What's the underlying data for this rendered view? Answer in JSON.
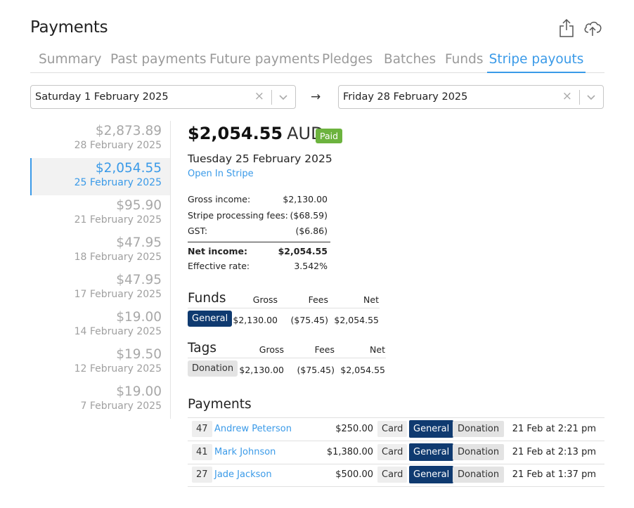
{
  "page": {
    "title": "Payments",
    "icons": [
      "share-icon",
      "cloud-upload-icon"
    ]
  },
  "tabs": [
    {
      "label": "Summary"
    },
    {
      "label": "Past payments"
    },
    {
      "label": "Future payments"
    },
    {
      "label": "Pledges"
    },
    {
      "label": "Batches"
    },
    {
      "label": "Funds"
    },
    {
      "label": "Stripe payouts",
      "active": true
    }
  ],
  "date_range": {
    "from": "Saturday 1 February 2025",
    "to": "Friday 28 February 2025",
    "arrow": "→",
    "clear_glyph": "×"
  },
  "payouts": [
    {
      "amount": "$2,873.89",
      "date": "28 February 2025"
    },
    {
      "amount": "$2,054.55",
      "date": "25 February 2025",
      "selected": true
    },
    {
      "amount": "$95.90",
      "date": "21 February 2025"
    },
    {
      "amount": "$47.95",
      "date": "18 February 2025"
    },
    {
      "amount": "$47.95",
      "date": "17 February 2025"
    },
    {
      "amount": "$19.00",
      "date": "14 February 2025"
    },
    {
      "amount": "$19.50",
      "date": "12 February 2025"
    },
    {
      "amount": "$19.00",
      "date": "7 February 2025"
    }
  ],
  "detail": {
    "amount": "$2,054.55",
    "currency": "AUD",
    "status": "Paid",
    "date": "Tuesday 25 February 2025",
    "stripe_link": "Open In Stripe",
    "summary": {
      "gross_label": "Gross income:",
      "gross_value": "$2,130.00",
      "fees_label": "Stripe processing fees:",
      "fees_value": "($68.59)",
      "gst_label": "GST:",
      "gst_value": "($6.86)",
      "net_label": "Net income:",
      "net_value": "$2,054.55",
      "rate_label": "Effective rate:",
      "rate_value": "3.542%"
    },
    "funds": {
      "title": "Funds",
      "headers": {
        "gross": "Gross",
        "fees": "Fees",
        "net": "Net"
      },
      "rows": [
        {
          "name": "General",
          "gross": "$2,130.00",
          "fees": "($75.45)",
          "net": "$2,054.55"
        }
      ]
    },
    "tags": {
      "title": "Tags",
      "headers": {
        "gross": "Gross",
        "fees": "Fees",
        "net": "Net"
      },
      "rows": [
        {
          "name": "Donation",
          "gross": "$2,130.00",
          "fees": "($75.45)",
          "net": "$2,054.55"
        }
      ]
    },
    "payments": {
      "title": "Payments",
      "rows": [
        {
          "num": "47",
          "name": "Andrew Peterson",
          "amount": "$250.00",
          "method": "Card",
          "fund": "General",
          "tag": "Donation",
          "time": "21 Feb at 2:21 pm"
        },
        {
          "num": "41",
          "name": "Mark Johnson",
          "amount": "$1,380.00",
          "method": "Card",
          "fund": "General",
          "tag": "Donation",
          "time": "21 Feb at 2:13 pm"
        },
        {
          "num": "27",
          "name": "Jade Jackson",
          "amount": "$500.00",
          "method": "Card",
          "fund": "General",
          "tag": "Donation",
          "time": "21 Feb at 1:37 pm"
        }
      ]
    }
  },
  "colors": {
    "accent": "#3a9ae8",
    "paid": "#6cb33e",
    "fund_chip": "#0f3a70",
    "tag_chip": "#e3e3e3"
  }
}
